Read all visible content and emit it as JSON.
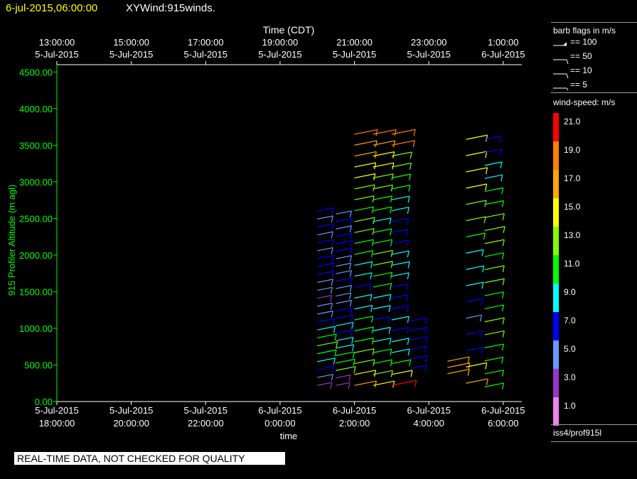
{
  "header": {
    "date_time": "6-jul-2015,06:00:00",
    "title": "XYWind:915winds.",
    "date_color": "#ffff00"
  },
  "chart_data": {
    "type": "wind-barb time-height",
    "top_axis_label": "Time (CDT)",
    "top_ticks": [
      {
        "time": "13:00:00",
        "date": "5-Jul-2015"
      },
      {
        "time": "15:00:00",
        "date": "5-Jul-2015"
      },
      {
        "time": "17:00:00",
        "date": "5-Jul-2015"
      },
      {
        "time": "19:00:00",
        "date": "5-Jul-2015"
      },
      {
        "time": "21:00:00",
        "date": "5-Jul-2015"
      },
      {
        "time": "23:00:00",
        "date": "5-Jul-2015"
      },
      {
        "time": "1:00:00",
        "date": "6-Jul-2015"
      }
    ],
    "bottom_axis_label": "time",
    "bottom_ticks": [
      {
        "date": "5-Jul-2015",
        "time": "18:00:00"
      },
      {
        "date": "5-Jul-2015",
        "time": "20:00:00"
      },
      {
        "date": "5-Jul-2015",
        "time": "22:00:00"
      },
      {
        "date": "6-Jul-2015",
        "time": "0:00:00"
      },
      {
        "date": "6-Jul-2015",
        "time": "2:00:00"
      },
      {
        "date": "6-Jul-2015",
        "time": "4:00:00"
      },
      {
        "date": "6-Jul-2015",
        "time": "6:00:00"
      }
    ],
    "x_range_hours_utc": [
      18,
      30.5
    ],
    "ylabel": "915 Profiler Altitude (m agl)",
    "ylim": [
      0,
      4600
    ],
    "y_ticks": [
      "0.00",
      "500.00",
      "1000.00",
      "1500.00",
      "2000.00",
      "2500.00",
      "3000.00",
      "3500.00",
      "4000.00",
      "4500.00"
    ],
    "y_tick_values": [
      0,
      500,
      1000,
      1500,
      2000,
      2500,
      3000,
      3500,
      4000,
      4500
    ],
    "axis_color": "#00ff00",
    "profiles": [
      {
        "hour_utc": 1.0,
        "min_alt": 220,
        "max_alt": 2600,
        "speeds": [
          3,
          5,
          7,
          9,
          11,
          13,
          11,
          9,
          7,
          5,
          4,
          3,
          4,
          5,
          6,
          7,
          6,
          5,
          6,
          5,
          6,
          5,
          6
        ]
      },
      {
        "hour_utc": 1.5,
        "min_alt": 220,
        "max_alt": 2560,
        "speeds": [
          2,
          3,
          12,
          11,
          10,
          9,
          8,
          7,
          8,
          7,
          6,
          5,
          4,
          5,
          6,
          5,
          4,
          5,
          6,
          7,
          6,
          5,
          6,
          5
        ]
      },
      {
        "hour_utc": 2.0,
        "min_alt": 220,
        "max_alt": 3650,
        "speeds": [
          16,
          15,
          13,
          12,
          11,
          11,
          10,
          9,
          8,
          7,
          8,
          9,
          10,
          11,
          12,
          13,
          11,
          12,
          13,
          14,
          15,
          16,
          17,
          18
        ]
      },
      {
        "hour_utc": 2.5,
        "min_alt": 220,
        "max_alt": 3650,
        "speeds": [
          15,
          12,
          11,
          10,
          9,
          8,
          7,
          8,
          9,
          10,
          11,
          12,
          12,
          11,
          10,
          9,
          10,
          11,
          12,
          13,
          14,
          15,
          16,
          18
        ]
      },
      {
        "hour_utc": 3.0,
        "min_alt": 220,
        "max_alt": 3650,
        "speeds": [
          21,
          14,
          11,
          9,
          8,
          7,
          8,
          7,
          6,
          7,
          8,
          9,
          8,
          7,
          6,
          7,
          8,
          9,
          10,
          11,
          12,
          13,
          18,
          19
        ]
      },
      {
        "hour_utc": 3.5,
        "min_alt": 450,
        "max_alt": 1100,
        "speeds": [
          6,
          7,
          6,
          7,
          6,
          7
        ]
      },
      {
        "hour_utc": 4.5,
        "min_alt": 380,
        "max_alt": 550,
        "speeds": [
          16,
          17,
          16
        ]
      },
      {
        "hour_utc": 5.0,
        "min_alt": 250,
        "max_alt": 3580,
        "speeds": [
          16,
          14,
          7,
          6,
          5,
          7,
          8,
          9,
          8,
          11,
          12,
          13,
          14,
          15,
          14,
          15
        ]
      },
      {
        "hour_utc": 5.5,
        "min_alt": 200,
        "max_alt": 3580,
        "speeds": [
          11,
          11,
          10,
          11,
          12,
          12,
          11,
          11,
          12,
          12,
          11,
          12,
          13,
          12,
          11,
          10,
          9,
          8,
          7,
          6
        ]
      }
    ]
  },
  "legend": {
    "barb_title": "barb flags in m/s",
    "barb_items": [
      "== 100",
      "== 50",
      "== 10",
      "== 5"
    ],
    "speed_title": "wind-speed: m/s",
    "speed_items": [
      {
        "label": "21.0",
        "color": "#ff0000"
      },
      {
        "label": "19.0",
        "color": "#ff7f00"
      },
      {
        "label": "17.0",
        "color": "#ffa500"
      },
      {
        "label": "15.0",
        "color": "#ffff00"
      },
      {
        "label": "13.0",
        "color": "#7fff00"
      },
      {
        "label": "11.0",
        "color": "#00ff00"
      },
      {
        "label": "9.0",
        "color": "#00ffff"
      },
      {
        "label": "7.0",
        "color": "#0000ff"
      },
      {
        "label": "5.0",
        "color": "#6699ff"
      },
      {
        "label": "3.0",
        "color": "#9933cc"
      },
      {
        "label": "1.0",
        "color": "#ee82ee"
      }
    ],
    "station": "iss4/prof915l"
  },
  "footer": {
    "qc_notice": "REAL-TIME DATA, NOT CHECKED FOR QUALITY"
  }
}
